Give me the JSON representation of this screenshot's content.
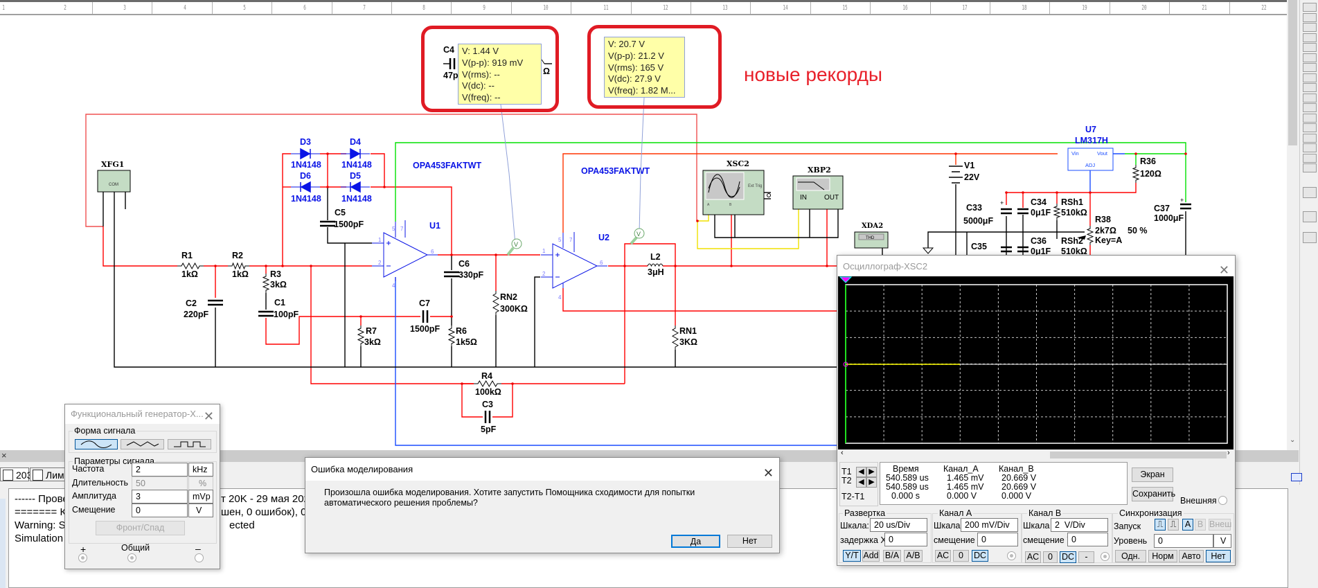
{
  "ruler": {
    "numbers": [
      "1",
      "2",
      "3",
      "4",
      "5",
      "6",
      "7",
      "8",
      "9",
      "10",
      "11",
      "12",
      "13",
      "14",
      "15",
      "16",
      "17",
      "18",
      "19",
      "20",
      "21",
      "22"
    ]
  },
  "annotation": "новые рекорды",
  "probes": [
    {
      "lines": [
        "V: 1.44 V",
        "V(p-p): 919 mV",
        "V(rms): --",
        "V(dc): --",
        "V(freq): --"
      ]
    },
    {
      "lines": [
        "V: 20.7 V",
        "V(p-p): 21.2 V",
        "V(rms): 165 V",
        "V(dc): 27.9 V",
        "V(freq): 1.82 M..."
      ]
    }
  ],
  "probe_symbol": "V",
  "schematic": {
    "C4": {
      "ref": "C4",
      "value": "47p",
      "extra": "Ω"
    },
    "XFG1": {
      "ref": "XFG1",
      "com": "COM"
    },
    "R1": {
      "ref": "R1",
      "value": "1kΩ"
    },
    "R2": {
      "ref": "R2",
      "value": "1kΩ"
    },
    "R3": {
      "ref": "R3",
      "value": "3kΩ"
    },
    "C1": {
      "ref": "C1",
      "value": "100pF"
    },
    "C2": {
      "ref": "C2",
      "value": "220pF"
    },
    "D3": {
      "ref": "D3",
      "value": "1N4148"
    },
    "D4": {
      "ref": "D4",
      "value": "1N4148"
    },
    "D5": {
      "ref": "D5",
      "value": "1N4148"
    },
    "D6": {
      "ref": "D6",
      "value": "1N4148"
    },
    "C5": {
      "ref": "C5",
      "value": "1500pF"
    },
    "U1": {
      "ref": "U1",
      "value": "OPA453FAKTWT"
    },
    "C6": {
      "ref": "C6",
      "value": "330pF"
    },
    "C7": {
      "ref": "C7",
      "value": "1500pF"
    },
    "R6": {
      "ref": "R6",
      "value": "1k5Ω"
    },
    "R7": {
      "ref": "R7",
      "value": "3kΩ"
    },
    "RN2": {
      "ref": "RN2",
      "value": "300KΩ"
    },
    "R4": {
      "ref": "R4",
      "value": "100kΩ"
    },
    "C3": {
      "ref": "C3",
      "value": "5pF"
    },
    "U2": {
      "ref": "U2",
      "value": "OPA453FAKTWT"
    },
    "L2": {
      "ref": "L2",
      "value": "3μH"
    },
    "RN1": {
      "ref": "RN1",
      "value": "3KΩ"
    },
    "XSC2": {
      "ref": "XSC2",
      "ext_trig": "Ext Trig",
      "pin_a": "A",
      "pin_b": "B"
    },
    "XBP2": {
      "ref": "XBP2",
      "in": "IN",
      "out": "OUT"
    },
    "XDA2": {
      "ref": "XDA2",
      "thd": "THD"
    },
    "V1": {
      "ref": "V1",
      "value": "22V"
    },
    "U7": {
      "ref": "U7",
      "value": "LM317H",
      "vin": "Vin",
      "vout": "Vout",
      "adj": "ADJ"
    },
    "R36": {
      "ref": "R36",
      "value": "120Ω"
    },
    "C33": {
      "ref": "C33",
      "value": "5000μF"
    },
    "C34": {
      "ref": "C34",
      "value": "0μ1F"
    },
    "C35": {
      "ref": "C35"
    },
    "C36": {
      "ref": "C36",
      "value": "0μ1F"
    },
    "RSh1": {
      "ref": "RSh1",
      "value": "510kΩ"
    },
    "RSh2": {
      "ref": "RSh2",
      "value": "510kΩ"
    },
    "R38": {
      "ref": "R38",
      "value": "2k7Ω",
      "key": "Key=A",
      "percent": "50 %"
    },
    "C37": {
      "ref": "C37",
      "value": "1000μF"
    },
    "opamp_pins": {
      "p1": "1",
      "p2": "2",
      "p4": "4",
      "p5": "5",
      "p6": "6",
      "p7": "7"
    }
  },
  "bottom_tabs": [
    {
      "label": "2030"
    },
    {
      "label": "Лими"
    }
  ],
  "log": [
    {
      "left": "------ Провер",
      "right": "т 20K - 29 мая 2025 г., 17"
    },
    {
      "left": "======= Ко",
      "right": "шен, 0 ошибок), 0 пре"
    },
    {
      "left": "Warning: Sing",
      "right": "ected"
    },
    {
      "left": "Simulation ca",
      "right": ""
    }
  ],
  "function_generator": {
    "title": "Функциональный генератор-X...",
    "waveform_group": "Форма сигнала",
    "waveforms": [
      {
        "name": "sine",
        "selected": true
      },
      {
        "name": "triangle",
        "selected": false
      },
      {
        "name": "square",
        "selected": false
      }
    ],
    "params_group": "Параметры сигнала",
    "params": [
      {
        "label": "Частота",
        "value": "2",
        "unit": "kHz",
        "enabled": true
      },
      {
        "label": "Длительность",
        "value": "50",
        "unit": "%",
        "enabled": false
      },
      {
        "label": "Амплитуда",
        "value": "3",
        "unit": "mVp",
        "enabled": true
      },
      {
        "label": "Смещение",
        "value": "0",
        "unit": "V",
        "enabled": true
      }
    ],
    "rise_fall_button": "Фронт/Спад",
    "terminals": {
      "plus": "+",
      "common": "Общий",
      "minus": "–"
    }
  },
  "error_dialog": {
    "title": "Ошибка моделирования",
    "message": "Произошла ошибка моделирования.  Хотите запустить Помощника сходимости для попытки автоматического решения проблемы?",
    "yes": "Да",
    "no": "Нет"
  },
  "oscilloscope": {
    "title": "Осциллограф-XSC2",
    "colors": {
      "channel_a": "#ffff00",
      "channel_b": "#ffffff",
      "cursor1": "#00ff00",
      "grid": "#c8c8c8"
    },
    "cursors": {
      "t1": "T1",
      "t2": "T2",
      "diff": "T2-T1"
    },
    "measure_headers": [
      "Время",
      "Канал_А",
      "Канал_B"
    ],
    "measure_rows": [
      [
        "540.589 us",
        "1.465 mV",
        "20.669 V"
      ],
      [
        "540.589 us",
        "1.465 mV",
        "20.669 V"
      ],
      [
        "0.000 s",
        "0.000 V",
        "0.000 V"
      ]
    ],
    "screen_button": "Экран",
    "save_button": "Сохранить",
    "external_label": "Внешняя",
    "timebase": {
      "title": "Развертка",
      "scale_label": "Шкала:",
      "scale": "20 us/Div",
      "xpos_label": "задержка X",
      "xpos": "0",
      "modes": [
        "Y/T",
        "Add",
        "B/A",
        "A/B"
      ],
      "active_mode": "Y/T"
    },
    "channel_a": {
      "title": "Канал A",
      "scale_label": "Шкала",
      "scale": "200 mV/Div",
      "ypos_label": "смещение Y",
      "ypos": "0",
      "coupling": [
        "AC",
        "0",
        "DC"
      ],
      "active": "DC"
    },
    "channel_b": {
      "title": "Канал B",
      "scale_label": "Шкала",
      "scale": "2  V/Div",
      "ypos_label": "смещение Y",
      "ypos": "0",
      "coupling": [
        "AC",
        "0",
        "DC",
        "-"
      ],
      "active": "DC"
    },
    "trigger": {
      "title": "Синхронизация",
      "edge_label": "Запуск",
      "sources": [
        "A",
        "B",
        "Внеш"
      ],
      "active_source": "A",
      "level_label": "Уровень",
      "level": "0",
      "level_unit": "V",
      "modes": [
        "Одн.",
        "Норм",
        "Авто",
        "Нет"
      ],
      "active_mode": "Нет"
    }
  }
}
